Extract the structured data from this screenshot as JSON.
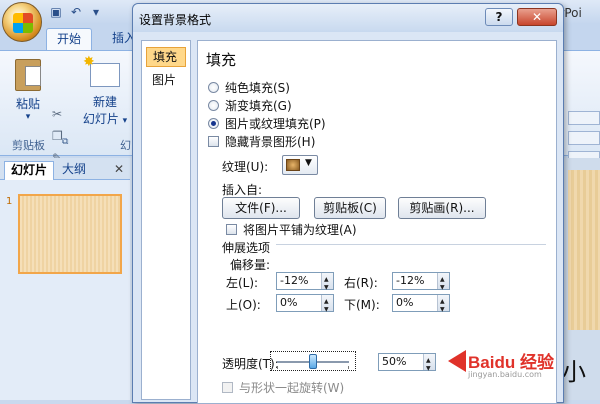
{
  "ppt": {
    "title_fragment": "erPoi",
    "tabs": [
      "开始",
      "插入"
    ],
    "ribbon": {
      "paste_label": "粘贴",
      "new_slide_label_1": "新建",
      "new_slide_label_2": "幻灯片",
      "clipboard_group": "剪贴板",
      "slides_group_fragment": "幻"
    },
    "panel_tabs": [
      "幻灯片",
      "大纲"
    ],
    "slide_number": "1",
    "canvas_text_fragment": "小"
  },
  "dialog": {
    "title": "设置背景格式",
    "help": "?",
    "close": "✕",
    "nav": [
      "填充",
      "图片"
    ],
    "heading": "填充",
    "fill_options": [
      {
        "label": "纯色填充(S)",
        "selected": false
      },
      {
        "label": "渐变填充(G)",
        "selected": false
      },
      {
        "label": "图片或纹理填充(P)",
        "selected": true
      }
    ],
    "hide_bg_graphics": "隐藏背景图形(H)",
    "texture_label": "纹理(U):",
    "insert_from": "插入自:",
    "buttons": {
      "file": "文件(F)...",
      "clipboard": "剪贴板(C)",
      "clipart": "剪贴画(R)..."
    },
    "tile_as_texture": "将图片平铺为纹理(A)",
    "stretch_options": "伸展选项",
    "offset": {
      "label": "偏移量:",
      "left_label": "左(L):",
      "left_value": "-12%",
      "right_label": "右(R):",
      "right_value": "-12%",
      "top_label": "上(O):",
      "top_value": "0%",
      "bottom_label": "下(M):",
      "bottom_value": "0%"
    },
    "transparency_label": "透明度(T):",
    "transparency_value": "50%",
    "transparency_level": 0.5,
    "rotate_with_shape": "与形状一起旋转(W)"
  },
  "watermark": {
    "text": "Baidu 经验",
    "sub": "jingyan.baidu.com"
  }
}
